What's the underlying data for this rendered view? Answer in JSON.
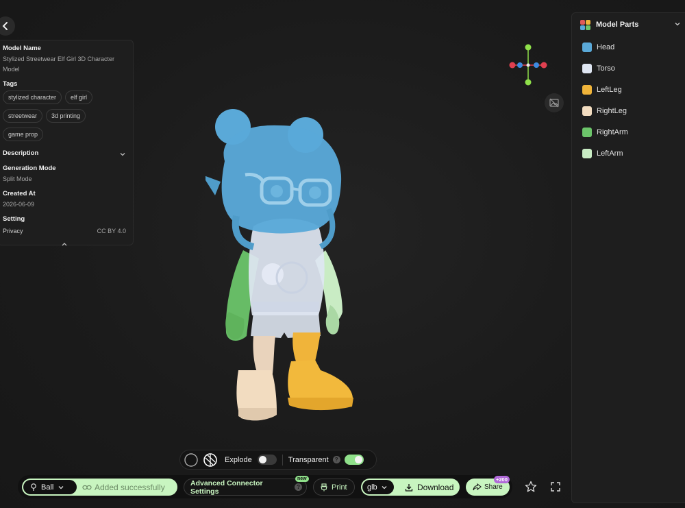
{
  "info": {
    "model_name_label": "Model Name",
    "model_name": "Stylized Streetwear Elf Girl 3D Character Model",
    "tags_label": "Tags",
    "tags": [
      "stylized character",
      "elf girl",
      "streetwear",
      "3d printing",
      "game prop"
    ],
    "description_label": "Description",
    "generation_mode_label": "Generation Mode",
    "generation_mode": "Split Mode",
    "created_at_label": "Created At",
    "created_at": "2026-06-09",
    "setting_label": "Setting",
    "privacy_label": "Privacy",
    "privacy_value": "CC BY 4.0"
  },
  "parts": {
    "title": "Model Parts",
    "items": [
      {
        "label": "Head",
        "color": "#5aa9d8"
      },
      {
        "label": "Torso",
        "color": "#dfe6f2"
      },
      {
        "label": "LeftLeg",
        "color": "#f0b43a"
      },
      {
        "label": "RightLeg",
        "color": "#f2dcc0"
      },
      {
        "label": "RightArm",
        "color": "#6cc56a"
      },
      {
        "label": "LeftArm",
        "color": "#c9ecc4"
      }
    ]
  },
  "toolbar": {
    "explode_label": "Explode",
    "explode_on": false,
    "transparent_label": "Transparent",
    "transparent_on": true,
    "help_glyph": "?"
  },
  "bottom": {
    "connector_select": "Ball",
    "added_text": "Added successfully",
    "advanced_label": "Advanced Connector Settings",
    "new_badge": "new",
    "print_label": "Print",
    "format_select": "glb",
    "download_label": "Download",
    "share_label": "Share",
    "share_badge": "+200"
  },
  "colors": {
    "accent": "#c8f5c0",
    "toggle_on": "#8fe08a"
  }
}
